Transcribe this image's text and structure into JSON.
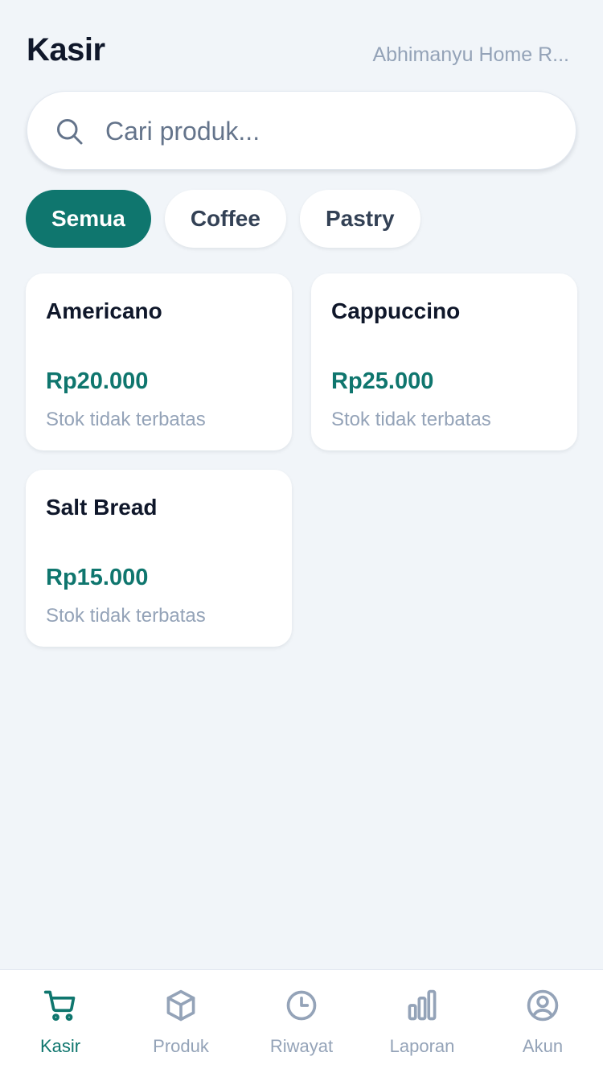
{
  "header": {
    "title": "Kasir",
    "store_name": "Abhimanyu Home R..."
  },
  "search": {
    "placeholder": "Cari produk...",
    "value": "",
    "icon": "search-icon"
  },
  "categories": [
    {
      "label": "Semua",
      "active": true
    },
    {
      "label": "Coffee",
      "active": false
    },
    {
      "label": "Pastry",
      "active": false
    }
  ],
  "products": [
    {
      "name": "Americano",
      "price": "Rp20.000",
      "stock": "Stok tidak terbatas"
    },
    {
      "name": "Cappuccino",
      "price": "Rp25.000",
      "stock": "Stok tidak terbatas"
    },
    {
      "name": "Salt Bread",
      "price": "Rp15.000",
      "stock": "Stok tidak terbatas"
    }
  ],
  "tabbar": {
    "items": [
      {
        "label": "Kasir",
        "icon": "cart-icon",
        "active": true
      },
      {
        "label": "Produk",
        "icon": "box-icon",
        "active": false
      },
      {
        "label": "Riwayat",
        "icon": "clock-icon",
        "active": false
      },
      {
        "label": "Laporan",
        "icon": "bar-chart-icon",
        "active": false
      },
      {
        "label": "Akun",
        "icon": "user-circle-icon",
        "active": false
      }
    ]
  },
  "colors": {
    "accent": "#0f766e",
    "background": "#f1f5f9",
    "muted": "#94a3b8",
    "text": "#0f172a"
  }
}
